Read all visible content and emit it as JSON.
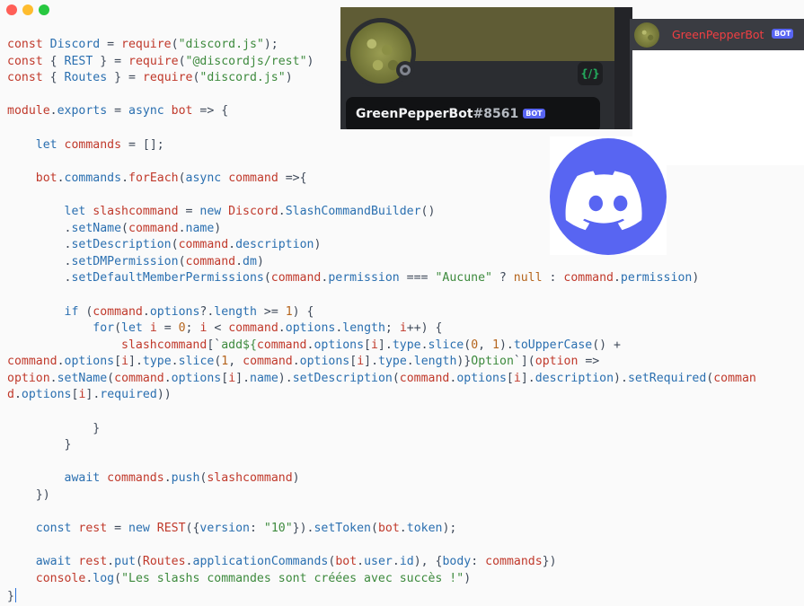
{
  "window": {
    "controls": [
      {
        "name": "close",
        "color": "#ff5f57"
      },
      {
        "name": "minimize",
        "color": "#febc2e"
      },
      {
        "name": "maximize",
        "color": "#28c840"
      }
    ]
  },
  "colors": {
    "keyword": "#c0392b",
    "identifier": "#2a6fb0",
    "string": "#3d8a3d",
    "punctuation": "#3f4a5a",
    "number": "#b5651d",
    "banner": "#5f5c35",
    "username_red": "#f23f42",
    "brand": "#5865f2"
  },
  "code_lines": [
    [
      [
        "const ",
        "k"
      ],
      [
        "Discord",
        "i"
      ],
      [
        " = ",
        "p"
      ],
      [
        "require",
        "k"
      ],
      [
        "(",
        "p"
      ],
      [
        "\"discord.js\"",
        "s"
      ],
      [
        ");",
        "p"
      ]
    ],
    [
      [
        "const ",
        "k"
      ],
      [
        "{ ",
        "p"
      ],
      [
        "REST",
        "i"
      ],
      [
        " } = ",
        "p"
      ],
      [
        "require",
        "k"
      ],
      [
        "(",
        "p"
      ],
      [
        "\"@discordjs/rest\"",
        "s"
      ],
      [
        ")",
        "p"
      ]
    ],
    [
      [
        "const ",
        "k"
      ],
      [
        "{ ",
        "p"
      ],
      [
        "Routes",
        "i"
      ],
      [
        " } = ",
        "p"
      ],
      [
        "require",
        "k"
      ],
      [
        "(",
        "p"
      ],
      [
        "\"discord.js\"",
        "s"
      ],
      [
        ")",
        "p"
      ]
    ],
    [],
    [
      [
        "module",
        "k"
      ],
      [
        ".",
        "p"
      ],
      [
        "exports",
        "i"
      ],
      [
        " = ",
        "p"
      ],
      [
        "async ",
        "i"
      ],
      [
        "bot",
        "k"
      ],
      [
        " => {",
        "p"
      ]
    ],
    [],
    [
      [
        "    let ",
        "i"
      ],
      [
        "commands",
        "k"
      ],
      [
        " = [];",
        "p"
      ]
    ],
    [],
    [
      [
        "    bot",
        "k"
      ],
      [
        ".",
        "p"
      ],
      [
        "commands",
        "i"
      ],
      [
        ".",
        "p"
      ],
      [
        "forEach",
        "k"
      ],
      [
        "(",
        "p"
      ],
      [
        "async ",
        "i"
      ],
      [
        "command",
        "k"
      ],
      [
        " =>{",
        "p"
      ]
    ],
    [],
    [
      [
        "        let ",
        "i"
      ],
      [
        "slashcommand",
        "k"
      ],
      [
        " = ",
        "p"
      ],
      [
        "new ",
        "i"
      ],
      [
        "Discord",
        "k"
      ],
      [
        ".",
        "p"
      ],
      [
        "SlashCommandBuilder",
        "i"
      ],
      [
        "()",
        "p"
      ]
    ],
    [
      [
        "        .",
        "p"
      ],
      [
        "setName",
        "i"
      ],
      [
        "(",
        "p"
      ],
      [
        "command",
        "k"
      ],
      [
        ".",
        "p"
      ],
      [
        "name",
        "i"
      ],
      [
        ")",
        "p"
      ]
    ],
    [
      [
        "        .",
        "p"
      ],
      [
        "setDescription",
        "i"
      ],
      [
        "(",
        "p"
      ],
      [
        "command",
        "k"
      ],
      [
        ".",
        "p"
      ],
      [
        "description",
        "i"
      ],
      [
        ")",
        "p"
      ]
    ],
    [
      [
        "        .",
        "p"
      ],
      [
        "setDMPermission",
        "i"
      ],
      [
        "(",
        "p"
      ],
      [
        "command",
        "k"
      ],
      [
        ".",
        "p"
      ],
      [
        "dm",
        "i"
      ],
      [
        ")",
        "p"
      ]
    ],
    [
      [
        "        .",
        "p"
      ],
      [
        "setDefaultMemberPermissions",
        "i"
      ],
      [
        "(",
        "p"
      ],
      [
        "command",
        "k"
      ],
      [
        ".",
        "p"
      ],
      [
        "permission",
        "i"
      ],
      [
        " === ",
        "p"
      ],
      [
        "\"Aucune\"",
        "s"
      ],
      [
        " ? ",
        "p"
      ],
      [
        "null",
        "n"
      ],
      [
        " : ",
        "p"
      ],
      [
        "command",
        "k"
      ],
      [
        ".",
        "p"
      ],
      [
        "permission",
        "i"
      ],
      [
        ")",
        "p"
      ]
    ],
    [],
    [
      [
        "        if ",
        "i"
      ],
      [
        "(",
        "p"
      ],
      [
        "command",
        "k"
      ],
      [
        ".",
        "p"
      ],
      [
        "options",
        "i"
      ],
      [
        "?.",
        "p"
      ],
      [
        "length",
        "i"
      ],
      [
        " >= ",
        "p"
      ],
      [
        "1",
        "n"
      ],
      [
        ") {",
        "p"
      ]
    ],
    [
      [
        "            for",
        "i"
      ],
      [
        "(",
        "p"
      ],
      [
        "let ",
        "i"
      ],
      [
        "i",
        "k"
      ],
      [
        " = ",
        "p"
      ],
      [
        "0",
        "n"
      ],
      [
        "; ",
        "p"
      ],
      [
        "i",
        "k"
      ],
      [
        " < ",
        "p"
      ],
      [
        "command",
        "k"
      ],
      [
        ".",
        "p"
      ],
      [
        "options",
        "i"
      ],
      [
        ".",
        "p"
      ],
      [
        "length",
        "i"
      ],
      [
        "; ",
        "p"
      ],
      [
        "i",
        "k"
      ],
      [
        "++) {",
        "p"
      ]
    ],
    [
      [
        "                slashcommand",
        "k"
      ],
      [
        "[`",
        "p"
      ],
      [
        "add${",
        "s"
      ],
      [
        "command",
        "k"
      ],
      [
        ".",
        "p"
      ],
      [
        "options",
        "i"
      ],
      [
        "[",
        "p"
      ],
      [
        "i",
        "k"
      ],
      [
        "].",
        "p"
      ],
      [
        "type",
        "i"
      ],
      [
        ".",
        "p"
      ],
      [
        "slice",
        "i"
      ],
      [
        "(",
        "p"
      ],
      [
        "0",
        "n"
      ],
      [
        ", ",
        "p"
      ],
      [
        "1",
        "n"
      ],
      [
        ").",
        "p"
      ],
      [
        "toUpperCase",
        "i"
      ],
      [
        "() +",
        "p"
      ]
    ],
    [
      [
        "command",
        "k"
      ],
      [
        ".",
        "p"
      ],
      [
        "options",
        "i"
      ],
      [
        "[",
        "p"
      ],
      [
        "i",
        "k"
      ],
      [
        "].",
        "p"
      ],
      [
        "type",
        "i"
      ],
      [
        ".",
        "p"
      ],
      [
        "slice",
        "i"
      ],
      [
        "(",
        "p"
      ],
      [
        "1",
        "n"
      ],
      [
        ", ",
        "p"
      ],
      [
        "command",
        "k"
      ],
      [
        ".",
        "p"
      ],
      [
        "options",
        "i"
      ],
      [
        "[",
        "p"
      ],
      [
        "i",
        "k"
      ],
      [
        "].",
        "p"
      ],
      [
        "type",
        "i"
      ],
      [
        ".",
        "p"
      ],
      [
        "length",
        "i"
      ],
      [
        ")}",
        "p"
      ],
      [
        "Option",
        "s"
      ],
      [
        "`](",
        "p"
      ],
      [
        "option",
        "k"
      ],
      [
        " =>",
        "p"
      ]
    ],
    [
      [
        "option",
        "k"
      ],
      [
        ".",
        "p"
      ],
      [
        "setName",
        "i"
      ],
      [
        "(",
        "p"
      ],
      [
        "command",
        "k"
      ],
      [
        ".",
        "p"
      ],
      [
        "options",
        "i"
      ],
      [
        "[",
        "p"
      ],
      [
        "i",
        "k"
      ],
      [
        "].",
        "p"
      ],
      [
        "name",
        "i"
      ],
      [
        ").",
        "p"
      ],
      [
        "setDescription",
        "i"
      ],
      [
        "(",
        "p"
      ],
      [
        "command",
        "k"
      ],
      [
        ".",
        "p"
      ],
      [
        "options",
        "i"
      ],
      [
        "[",
        "p"
      ],
      [
        "i",
        "k"
      ],
      [
        "].",
        "p"
      ],
      [
        "description",
        "i"
      ],
      [
        ").",
        "p"
      ],
      [
        "setRequired",
        "i"
      ],
      [
        "(",
        "p"
      ],
      [
        "comman",
        "k"
      ]
    ],
    [
      [
        "d",
        "k"
      ],
      [
        ".",
        "p"
      ],
      [
        "options",
        "i"
      ],
      [
        "[",
        "p"
      ],
      [
        "i",
        "k"
      ],
      [
        "].",
        "p"
      ],
      [
        "required",
        "i"
      ],
      [
        "))",
        "p"
      ]
    ],
    [],
    [
      [
        "            }",
        "p"
      ]
    ],
    [
      [
        "        }",
        "p"
      ]
    ],
    [],
    [
      [
        "        await ",
        "i"
      ],
      [
        "commands",
        "k"
      ],
      [
        ".",
        "p"
      ],
      [
        "push",
        "i"
      ],
      [
        "(",
        "p"
      ],
      [
        "slashcommand",
        "k"
      ],
      [
        ")",
        "p"
      ]
    ],
    [
      [
        "    })",
        "p"
      ]
    ],
    [],
    [
      [
        "    const ",
        "i"
      ],
      [
        "rest",
        "k"
      ],
      [
        " = ",
        "p"
      ],
      [
        "new ",
        "i"
      ],
      [
        "REST",
        "k"
      ],
      [
        "({",
        "p"
      ],
      [
        "version",
        "i"
      ],
      [
        ": ",
        "p"
      ],
      [
        "\"10\"",
        "s"
      ],
      [
        "}).",
        "p"
      ],
      [
        "setToken",
        "i"
      ],
      [
        "(",
        "p"
      ],
      [
        "bot",
        "k"
      ],
      [
        ".",
        "p"
      ],
      [
        "token",
        "i"
      ],
      [
        ");",
        "p"
      ]
    ],
    [],
    [
      [
        "    await ",
        "i"
      ],
      [
        "rest",
        "k"
      ],
      [
        ".",
        "p"
      ],
      [
        "put",
        "i"
      ],
      [
        "(",
        "p"
      ],
      [
        "Routes",
        "k"
      ],
      [
        ".",
        "p"
      ],
      [
        "applicationCommands",
        "i"
      ],
      [
        "(",
        "p"
      ],
      [
        "bot",
        "k"
      ],
      [
        ".",
        "p"
      ],
      [
        "user",
        "i"
      ],
      [
        ".",
        "p"
      ],
      [
        "id",
        "i"
      ],
      [
        "), {",
        "p"
      ],
      [
        "body",
        "i"
      ],
      [
        ": ",
        "p"
      ],
      [
        "commands",
        "k"
      ],
      [
        "})",
        "p"
      ]
    ],
    [
      [
        "    console",
        "k"
      ],
      [
        ".",
        "p"
      ],
      [
        "log",
        "i"
      ],
      [
        "(",
        "p"
      ],
      [
        "\"Les slashs commandes sont créées avec succès !\"",
        "s"
      ],
      [
        ")",
        "p"
      ]
    ],
    [
      [
        "}",
        "p"
      ]
    ]
  ],
  "profile": {
    "name": "GreenPepperBot",
    "discriminator": "#8561",
    "bot_tag": "BOT",
    "dev_badge": "{/}",
    "avatar_icon": "green-peppercorns-avatar",
    "status": "offline"
  },
  "member_list": {
    "name": "GreenPepperBot",
    "bot_tag": "BOT",
    "avatar_icon": "green-peppercorns-avatar"
  },
  "logo": {
    "icon": "discord-logo-icon"
  }
}
